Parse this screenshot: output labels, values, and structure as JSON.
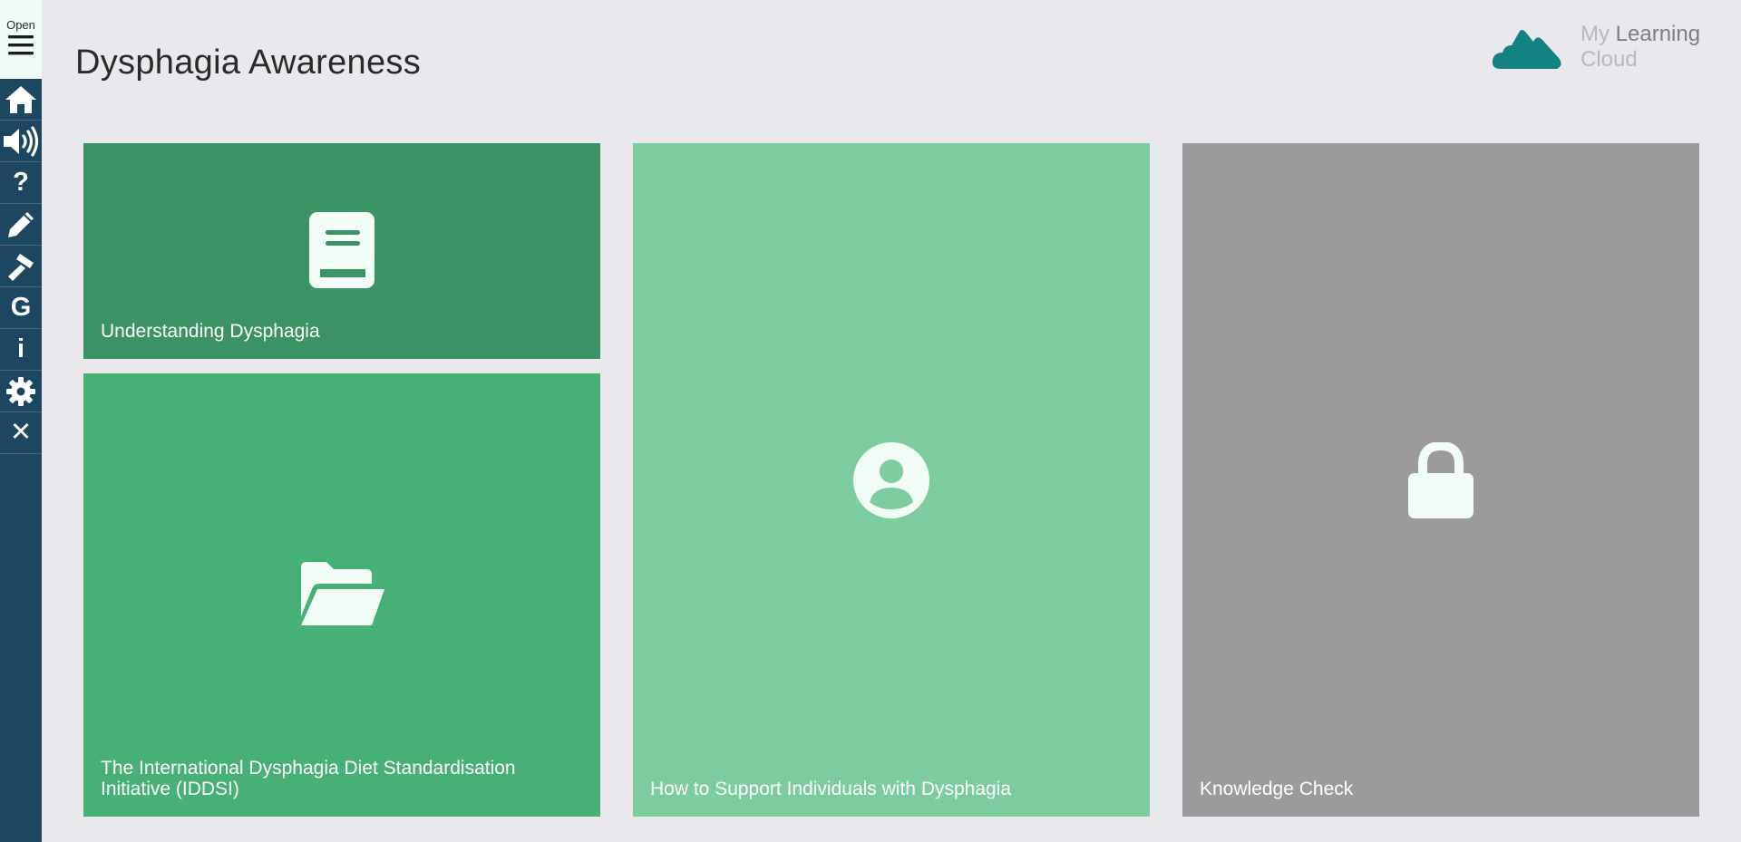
{
  "sidebar": {
    "toggle_label": "Open",
    "items": [
      {
        "name": "home",
        "glyph": ""
      },
      {
        "name": "audio",
        "glyph": ""
      },
      {
        "name": "help",
        "glyph": "?"
      },
      {
        "name": "notes",
        "glyph": ""
      },
      {
        "name": "tools",
        "glyph": ""
      },
      {
        "name": "glossary",
        "glyph": "G"
      },
      {
        "name": "info",
        "glyph": "i"
      },
      {
        "name": "settings",
        "glyph": ""
      },
      {
        "name": "close",
        "glyph": "✕"
      }
    ]
  },
  "header": {
    "title": "Dysphagia Awareness",
    "logo_line1_light": "My ",
    "logo_line1_strong": "Learning",
    "logo_line2": "Cloud"
  },
  "tiles": [
    {
      "label": "Understanding Dysphagia",
      "icon": "book-icon",
      "color": "#3b9264"
    },
    {
      "label": "The International Dysphagia Diet Standardisation Initiative (IDDSI)",
      "icon": "folder-open-icon",
      "color": "#47b077"
    },
    {
      "label": "How to Support Individuals with Dysphagia",
      "icon": "user-circle-icon",
      "color": "#7ccca0"
    },
    {
      "label": "Knowledge Check",
      "icon": "lock-icon",
      "color": "#9c9a9d"
    }
  ],
  "colors": {
    "sidebar": "#1d4760",
    "background": "#e9e8ed",
    "logo": "#138283",
    "icon_fill": "#f2fcf7"
  }
}
